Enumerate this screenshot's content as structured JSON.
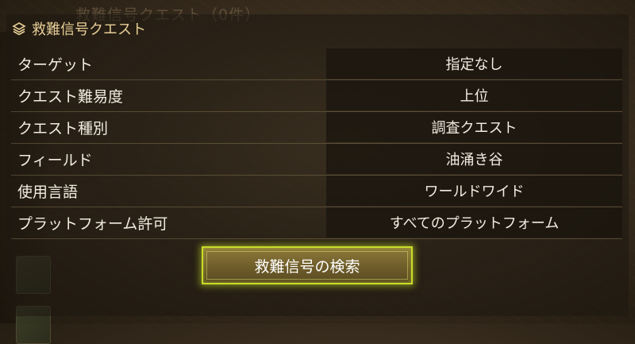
{
  "background_title": "救難信号クエスト（0件）",
  "panel": {
    "title": "救難信号クエスト",
    "title_icon": "layers-icon"
  },
  "filters": [
    {
      "label": "ターゲット",
      "value": "指定なし"
    },
    {
      "label": "クエスト難易度",
      "value": "上位"
    },
    {
      "label": "クエスト種別",
      "value": "調査クエスト"
    },
    {
      "label": "フィールド",
      "value": "油涌き谷"
    },
    {
      "label": "使用言語",
      "value": "ワールドワイド"
    },
    {
      "label": "プラットフォーム許可",
      "value": "すべてのプラットフォーム"
    }
  ],
  "search_button": {
    "label": "救難信号の検索"
  },
  "colors": {
    "accent": "#c9dc2a",
    "header_text": "#e8cf97",
    "row_text": "#f2ece0"
  }
}
